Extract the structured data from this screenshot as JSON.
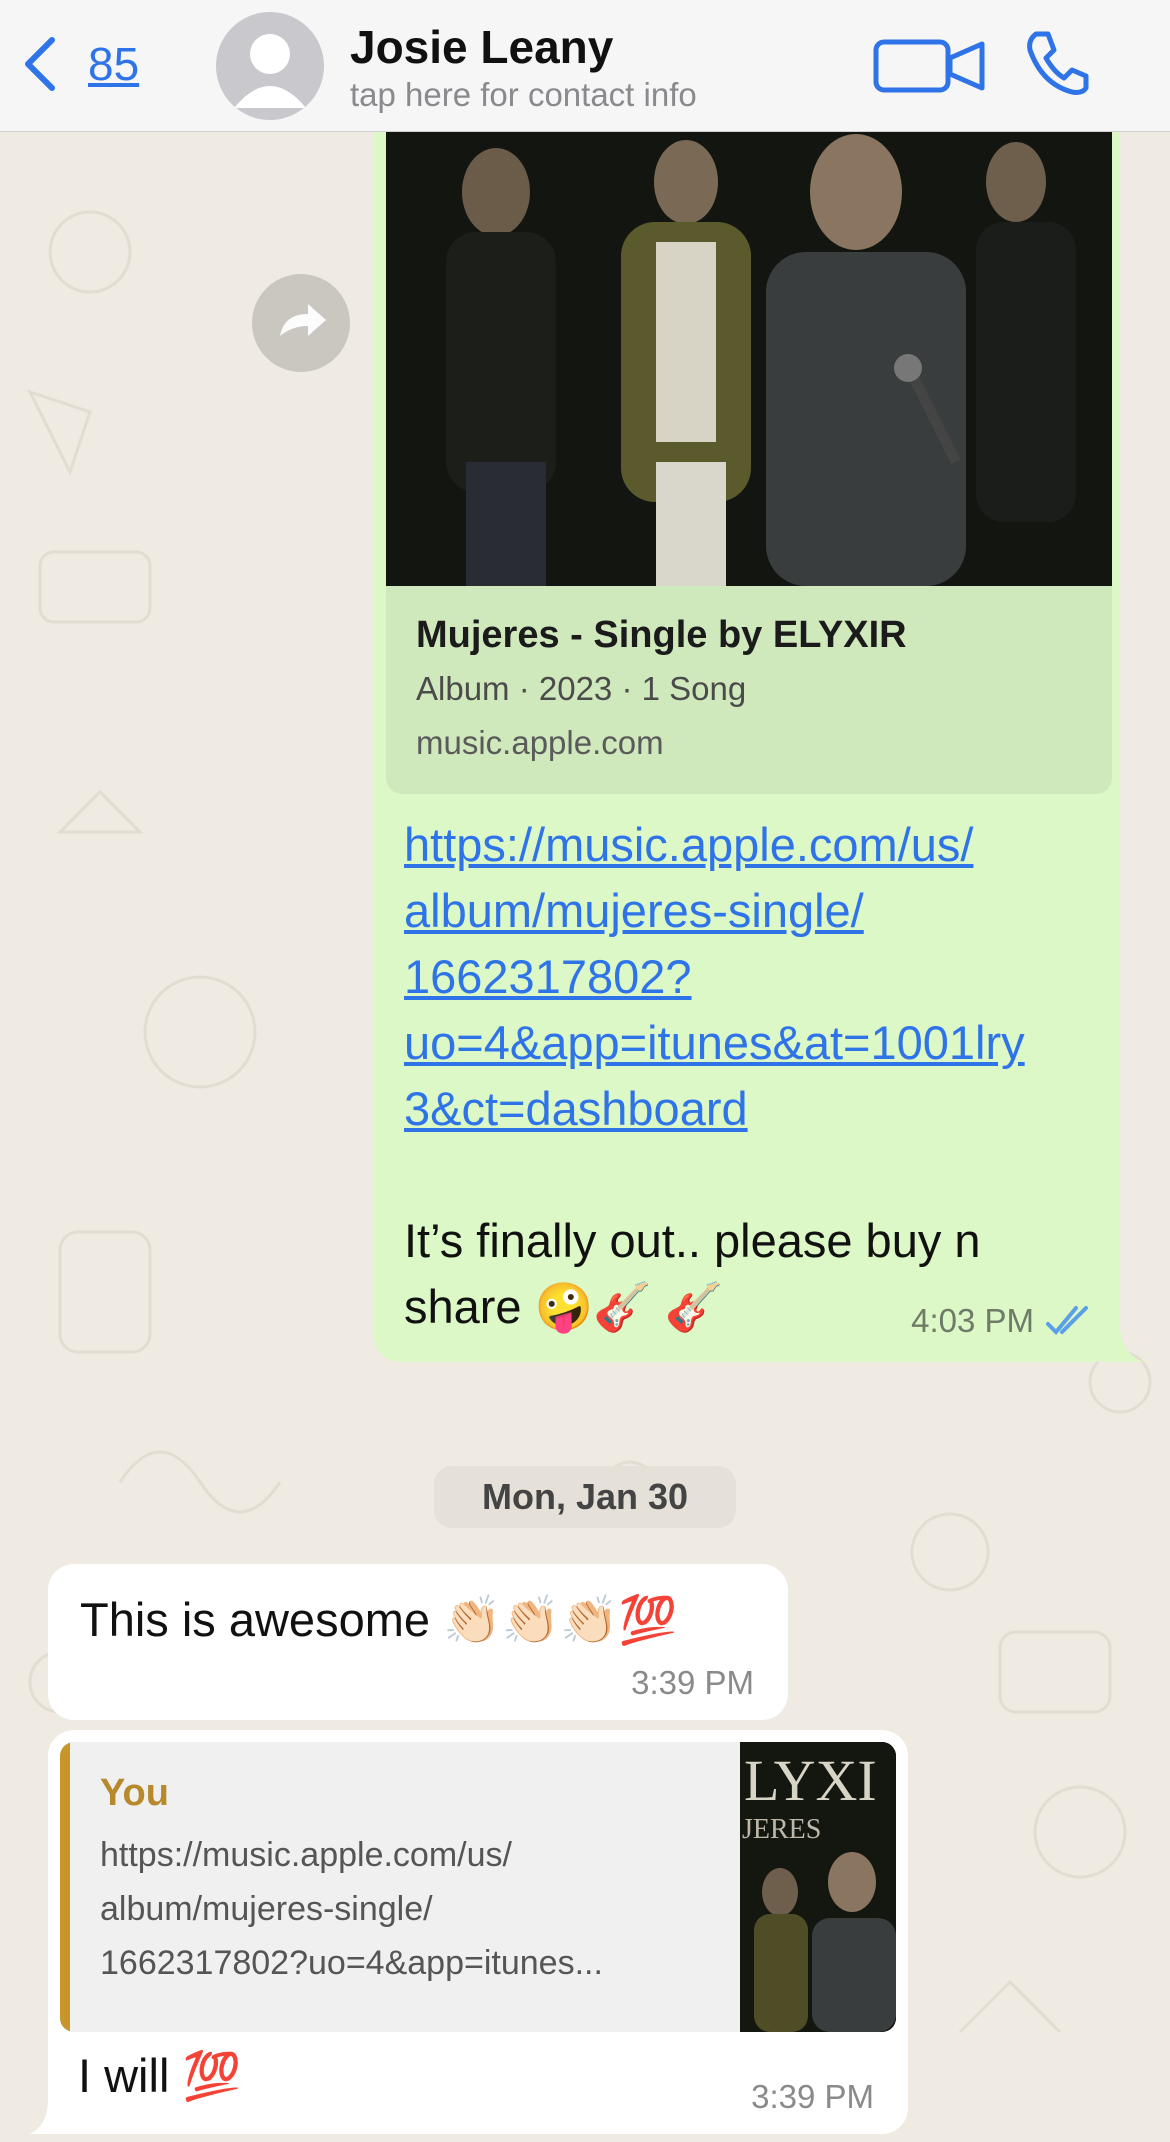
{
  "header": {
    "back_count": "85",
    "contact_name": "Josie Leany",
    "contact_subtitle": "tap here for contact info"
  },
  "outgoing": {
    "preview_title": "Mujeres - Single by ELYXIR",
    "preview_meta": "Album · 2023 · 1 Song",
    "preview_host": "music.apple.com",
    "link_lines": [
      "https://music.apple.com/us/",
      "album/mujeres-single/",
      "1662317802?",
      "uo=4&app=itunes&at=1001lry",
      "3&ct=dashboard"
    ],
    "text_lines": [
      "It’s finally out.. please buy n",
      "share 🤪🎸 🎸"
    ],
    "time": "4:03 PM"
  },
  "date_divider": "Mon, Jan 30",
  "incoming": [
    {
      "text": "This is awesome 👏🏻👏🏻👏🏻💯",
      "time": "3:39 PM"
    },
    {
      "quote_author": "You",
      "quote_lines": [
        "https://music.apple.com/us/",
        "album/mujeres-single/",
        "1662317802?uo=4&app=itunes..."
      ],
      "thumb_text": "LYXI",
      "thumb_sub": "JERES",
      "text": "I will 💯",
      "time": "3:39 PM"
    }
  ],
  "colors": {
    "accent": "#2f73e8",
    "outgoing_bubble": "#dcf8c6",
    "incoming_bubble": "#ffffff",
    "quote_bar": "#c8952b",
    "wallpaper": "#efeae2"
  }
}
